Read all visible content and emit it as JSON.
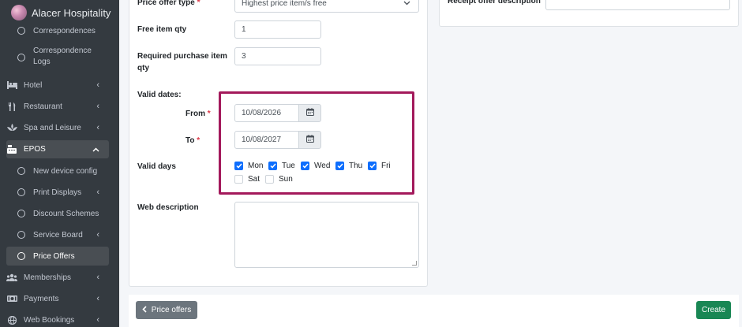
{
  "brand": {
    "name": "Alacer Hospitality"
  },
  "sidebar": {
    "items": [
      {
        "label": "Correspondences",
        "icon": "circle-icon"
      },
      {
        "label": "Correspondence Logs",
        "icon": "circle-icon"
      },
      {
        "label": "Hotel",
        "icon": "bed-icon"
      },
      {
        "label": "Restaurant",
        "icon": "utensils-icon"
      },
      {
        "label": "Spa and Leisure",
        "icon": "spa-icon"
      },
      {
        "label": "EPOS",
        "icon": "cash-register-icon"
      },
      {
        "label": "New device config",
        "icon": "circle-icon"
      },
      {
        "label": "Print Displays",
        "icon": "circle-icon"
      },
      {
        "label": "Discount Schemes",
        "icon": "circle-icon"
      },
      {
        "label": "Service Board",
        "icon": "circle-icon"
      },
      {
        "label": "Price Offers",
        "icon": "circle-icon"
      },
      {
        "label": "Memberships",
        "icon": "users-icon"
      },
      {
        "label": "Payments",
        "icon": "payment-icon"
      },
      {
        "label": "Web Bookings",
        "icon": "globe-icon"
      }
    ]
  },
  "form": {
    "price_offer_type": {
      "label": "Price offer type",
      "value": "Highest price item/s free"
    },
    "free_item_qty": {
      "label": "Free item qty",
      "value": "1"
    },
    "required_purchase_qty": {
      "label_line1": "Required purchase item",
      "label_line2": "qty",
      "value": "3"
    },
    "valid_dates": {
      "label": "Valid dates:",
      "from_label": "From",
      "from_value": "10/08/2026",
      "to_label": "To",
      "to_value": "10/08/2027"
    },
    "valid_days": {
      "label": "Valid days",
      "days": [
        {
          "label": "Mon",
          "checked": true
        },
        {
          "label": "Tue",
          "checked": true
        },
        {
          "label": "Wed",
          "checked": true
        },
        {
          "label": "Thu",
          "checked": true
        },
        {
          "label": "Fri",
          "checked": true
        },
        {
          "label": "Sat",
          "checked": false
        },
        {
          "label": "Sun",
          "checked": false
        }
      ]
    },
    "web_description": {
      "label": "Web description",
      "value": ""
    },
    "receipt_offer_description": {
      "label": "Receipt offer description",
      "value": ""
    },
    "required_mark": "*"
  },
  "footer": {
    "back_label": "Price offers",
    "create_label": "Create"
  },
  "colors": {
    "sidebar_bg": "#343a40",
    "highlight": "#a3195b",
    "checkbox": "#0d6efd",
    "create": "#198754",
    "back": "#6c757d"
  }
}
